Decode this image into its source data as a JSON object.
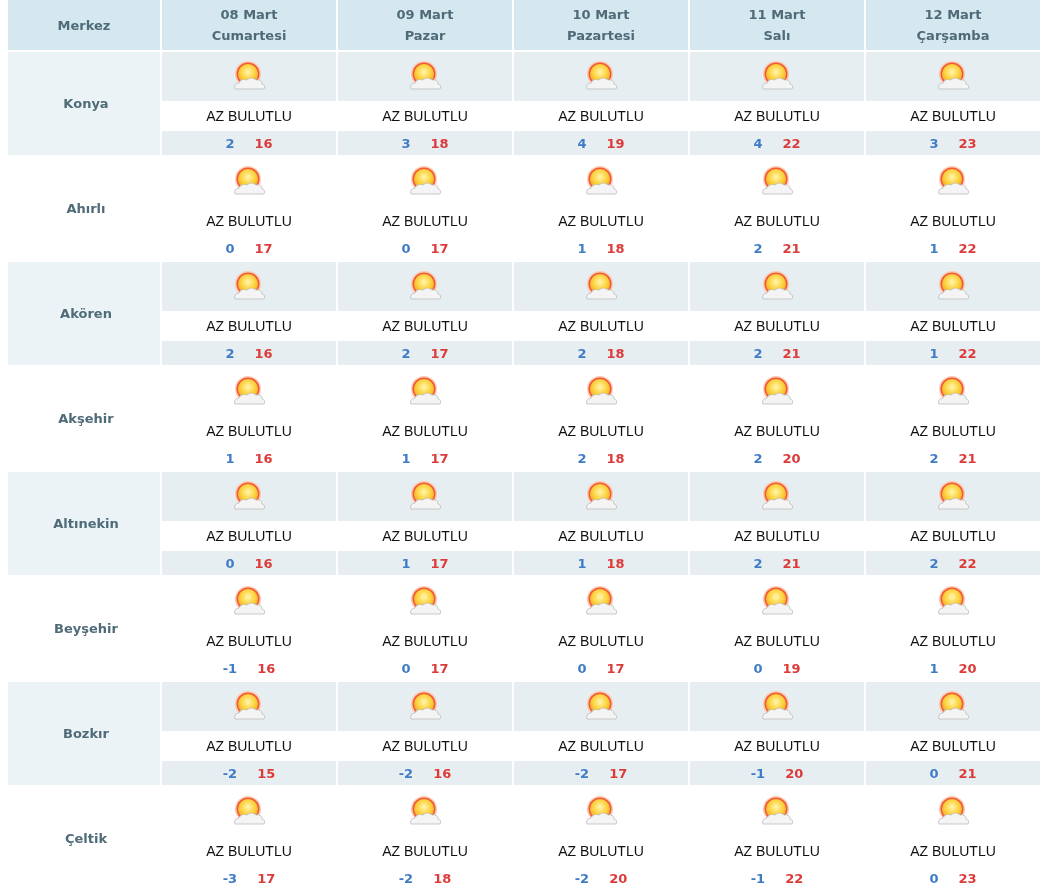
{
  "header": {
    "location_label": "Merkez",
    "days": [
      {
        "date": "08 Mart",
        "weekday": "Cumartesi"
      },
      {
        "date": "09 Mart",
        "weekday": "Pazar"
      },
      {
        "date": "10 Mart",
        "weekday": "Pazartesi"
      },
      {
        "date": "11 Mart",
        "weekday": "Salı"
      },
      {
        "date": "12 Mart",
        "weekday": "Çarşamba"
      }
    ]
  },
  "rows": [
    {
      "city": "Konya",
      "forecasts": [
        {
          "condition": "AZ BULUTLU",
          "min": "2",
          "max": "16"
        },
        {
          "condition": "AZ BULUTLU",
          "min": "3",
          "max": "18"
        },
        {
          "condition": "AZ BULUTLU",
          "min": "4",
          "max": "19"
        },
        {
          "condition": "AZ BULUTLU",
          "min": "4",
          "max": "22"
        },
        {
          "condition": "AZ BULUTLU",
          "min": "3",
          "max": "23"
        }
      ]
    },
    {
      "city": "Ahırlı",
      "forecasts": [
        {
          "condition": "AZ BULUTLU",
          "min": "0",
          "max": "17"
        },
        {
          "condition": "AZ BULUTLU",
          "min": "0",
          "max": "17"
        },
        {
          "condition": "AZ BULUTLU",
          "min": "1",
          "max": "18"
        },
        {
          "condition": "AZ BULUTLU",
          "min": "2",
          "max": "21"
        },
        {
          "condition": "AZ BULUTLU",
          "min": "1",
          "max": "22"
        }
      ]
    },
    {
      "city": "Akören",
      "forecasts": [
        {
          "condition": "AZ BULUTLU",
          "min": "2",
          "max": "16"
        },
        {
          "condition": "AZ BULUTLU",
          "min": "2",
          "max": "17"
        },
        {
          "condition": "AZ BULUTLU",
          "min": "2",
          "max": "18"
        },
        {
          "condition": "AZ BULUTLU",
          "min": "2",
          "max": "21"
        },
        {
          "condition": "AZ BULUTLU",
          "min": "1",
          "max": "22"
        }
      ]
    },
    {
      "city": "Akşehir",
      "forecasts": [
        {
          "condition": "AZ BULUTLU",
          "min": "1",
          "max": "16"
        },
        {
          "condition": "AZ BULUTLU",
          "min": "1",
          "max": "17"
        },
        {
          "condition": "AZ BULUTLU",
          "min": "2",
          "max": "18"
        },
        {
          "condition": "AZ BULUTLU",
          "min": "2",
          "max": "20"
        },
        {
          "condition": "AZ BULUTLU",
          "min": "2",
          "max": "21"
        }
      ]
    },
    {
      "city": "Altınekin",
      "forecasts": [
        {
          "condition": "AZ BULUTLU",
          "min": "0",
          "max": "16"
        },
        {
          "condition": "AZ BULUTLU",
          "min": "1",
          "max": "17"
        },
        {
          "condition": "AZ BULUTLU",
          "min": "1",
          "max": "18"
        },
        {
          "condition": "AZ BULUTLU",
          "min": "2",
          "max": "21"
        },
        {
          "condition": "AZ BULUTLU",
          "min": "2",
          "max": "22"
        }
      ]
    },
    {
      "city": "Beyşehir",
      "forecasts": [
        {
          "condition": "AZ BULUTLU",
          "min": "-1",
          "max": "16"
        },
        {
          "condition": "AZ BULUTLU",
          "min": "0",
          "max": "17"
        },
        {
          "condition": "AZ BULUTLU",
          "min": "0",
          "max": "17"
        },
        {
          "condition": "AZ BULUTLU",
          "min": "0",
          "max": "19"
        },
        {
          "condition": "AZ BULUTLU",
          "min": "1",
          "max": "20"
        }
      ]
    },
    {
      "city": "Bozkır",
      "forecasts": [
        {
          "condition": "AZ BULUTLU",
          "min": "-2",
          "max": "15"
        },
        {
          "condition": "AZ BULUTLU",
          "min": "-2",
          "max": "16"
        },
        {
          "condition": "AZ BULUTLU",
          "min": "-2",
          "max": "17"
        },
        {
          "condition": "AZ BULUTLU",
          "min": "-1",
          "max": "20"
        },
        {
          "condition": "AZ BULUTLU",
          "min": "0",
          "max": "21"
        }
      ]
    },
    {
      "city": "Çeltik",
      "forecasts": [
        {
          "condition": "AZ BULUTLU",
          "min": "-3",
          "max": "17"
        },
        {
          "condition": "AZ BULUTLU",
          "min": "-2",
          "max": "18"
        },
        {
          "condition": "AZ BULUTLU",
          "min": "-2",
          "max": "20"
        },
        {
          "condition": "AZ BULUTLU",
          "min": "-1",
          "max": "22"
        },
        {
          "condition": "AZ BULUTLU",
          "min": "0",
          "max": "23"
        }
      ]
    }
  ]
}
